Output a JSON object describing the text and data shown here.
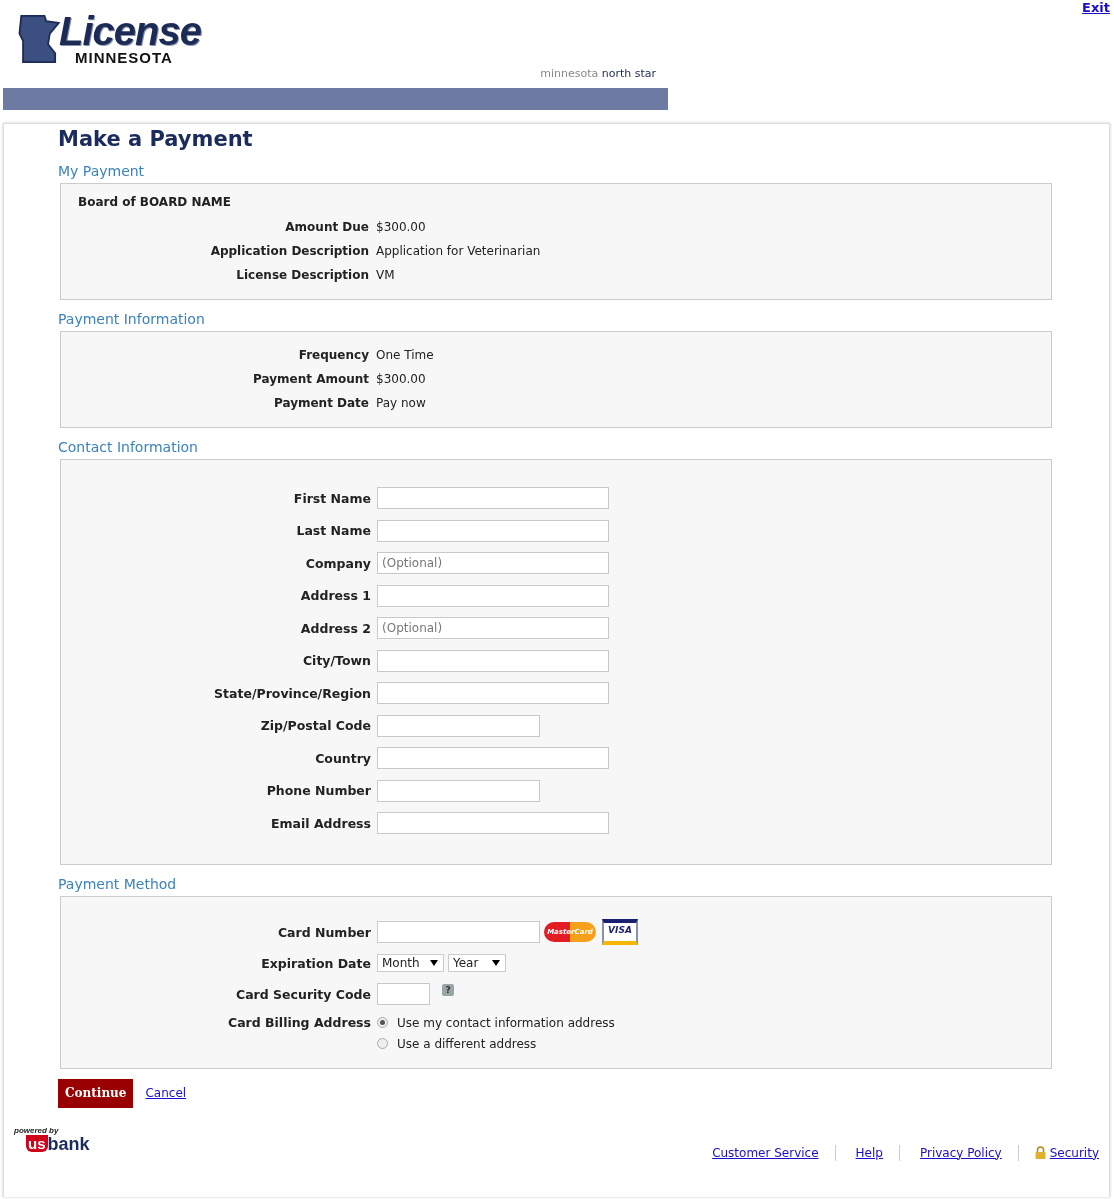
{
  "header": {
    "logo_title": "License",
    "logo_subtitle": "MINNESOTA",
    "partner_light": "minnesota",
    "partner_dark": "north star",
    "exit_link": "Exit"
  },
  "page_title": "Make a Payment",
  "my_payment": {
    "heading": "My Payment",
    "board": "Board of BOARD NAME",
    "rows": [
      {
        "label": "Amount Due",
        "value": "$300.00"
      },
      {
        "label": "Application Description",
        "value": "Application for Veterinarian"
      },
      {
        "label": "License Description",
        "value": "VM"
      }
    ]
  },
  "payment_information": {
    "heading": "Payment Information",
    "rows": [
      {
        "label": "Frequency",
        "value": "One Time"
      },
      {
        "label": "Payment Amount",
        "value": "$300.00"
      },
      {
        "label": "Payment Date",
        "value": "Pay now"
      }
    ]
  },
  "contact_information": {
    "heading": "Contact Information",
    "fields": [
      {
        "label": "First Name",
        "kind": "wide"
      },
      {
        "label": "Last Name",
        "kind": "wide"
      },
      {
        "label": "Company",
        "kind": "wide",
        "placeholder": "(Optional)"
      },
      {
        "label": "Address 1",
        "kind": "wide"
      },
      {
        "label": "Address 2",
        "kind": "wide",
        "placeholder": "(Optional)"
      },
      {
        "label": "City/Town",
        "kind": "wide"
      },
      {
        "label": "State/Province/Region",
        "kind": "wide"
      },
      {
        "label": "Zip/Postal Code",
        "kind": "narrow"
      },
      {
        "label": "Country",
        "kind": "wide"
      },
      {
        "label": "Phone Number",
        "kind": "narrow"
      },
      {
        "label": "Email Address",
        "kind": "wide"
      }
    ]
  },
  "payment_method": {
    "heading": "Payment Method",
    "card_number_label": "Card Number",
    "card_logos": [
      "MasterCard",
      "VISA"
    ],
    "expiration_label": "Expiration Date",
    "month": "Month",
    "year": "Year",
    "security_label": "Card Security Code",
    "help_mark": "?",
    "billing_label": "Card Billing Address",
    "billing_options": [
      {
        "label": "Use my contact information address",
        "selected": true
      },
      {
        "label": "Use a different address",
        "selected": false
      }
    ]
  },
  "buttons": {
    "continue": "Continue",
    "cancel": "Cancel"
  },
  "footer": {
    "powered_by": "powered by",
    "bank_us": "us",
    "bank_name": "bank",
    "links": [
      {
        "label": "Customer Service",
        "kind": "plain"
      },
      {
        "label": "Help",
        "kind": "plain"
      },
      {
        "label": "Privacy Policy",
        "kind": "plain"
      },
      {
        "label": "Security",
        "kind": "lock"
      }
    ]
  }
}
